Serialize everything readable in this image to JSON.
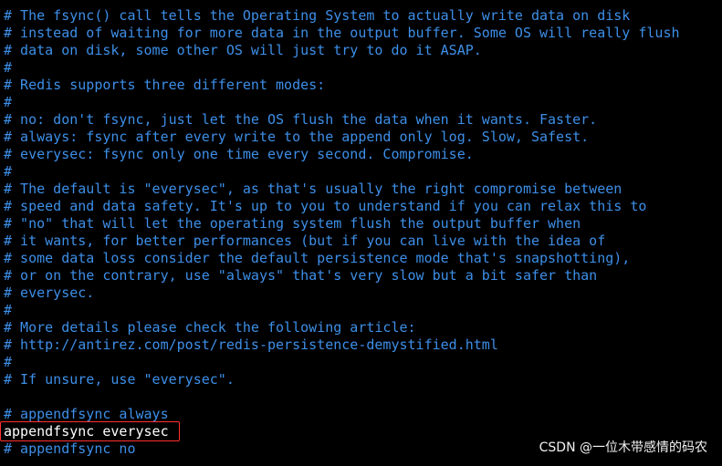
{
  "terminal": {
    "lines": [
      {
        "type": "comment",
        "text": "# The fsync() call tells the Operating System to actually write data on disk"
      },
      {
        "type": "comment",
        "text": "# instead of waiting for more data in the output buffer. Some OS will really flush"
      },
      {
        "type": "comment",
        "text": "# data on disk, some other OS will just try to do it ASAP."
      },
      {
        "type": "comment",
        "text": "#"
      },
      {
        "type": "comment",
        "text": "# Redis supports three different modes:"
      },
      {
        "type": "comment",
        "text": "#"
      },
      {
        "type": "comment",
        "text": "# no: don't fsync, just let the OS flush the data when it wants. Faster."
      },
      {
        "type": "comment",
        "text": "# always: fsync after every write to the append only log. Slow, Safest."
      },
      {
        "type": "comment",
        "text": "# everysec: fsync only one time every second. Compromise."
      },
      {
        "type": "comment",
        "text": "#"
      },
      {
        "type": "comment",
        "text": "# The default is \"everysec\", as that's usually the right compromise between"
      },
      {
        "type": "comment",
        "text": "# speed and data safety. It's up to you to understand if you can relax this to"
      },
      {
        "type": "comment",
        "text": "# \"no\" that will let the operating system flush the output buffer when"
      },
      {
        "type": "comment",
        "text": "# it wants, for better performances (but if you can live with the idea of"
      },
      {
        "type": "comment",
        "text": "# some data loss consider the default persistence mode that's snapshotting),"
      },
      {
        "type": "comment",
        "text": "# or on the contrary, use \"always\" that's very slow but a bit safer than"
      },
      {
        "type": "comment",
        "text": "# everysec."
      },
      {
        "type": "comment",
        "text": "#"
      },
      {
        "type": "comment",
        "text": "# More details please check the following article:"
      },
      {
        "type": "comment",
        "text": "# http://antirez.com/post/redis-persistence-demystified.html"
      },
      {
        "type": "comment",
        "text": "#"
      },
      {
        "type": "comment",
        "text": "# If unsure, use \"everysec\"."
      },
      {
        "type": "blank",
        "text": ""
      },
      {
        "type": "comment",
        "text": "# appendfsync always"
      },
      {
        "type": "code",
        "text": "appendfsync everysec"
      },
      {
        "type": "comment",
        "text": "# appendfsync no"
      }
    ]
  },
  "watermark": {
    "text": "CSDN @一位木带感情的码农"
  },
  "colors": {
    "background": "#000000",
    "comment": "#3d8fe8",
    "code": "#ffffff",
    "highlight_border": "#ff3030"
  }
}
